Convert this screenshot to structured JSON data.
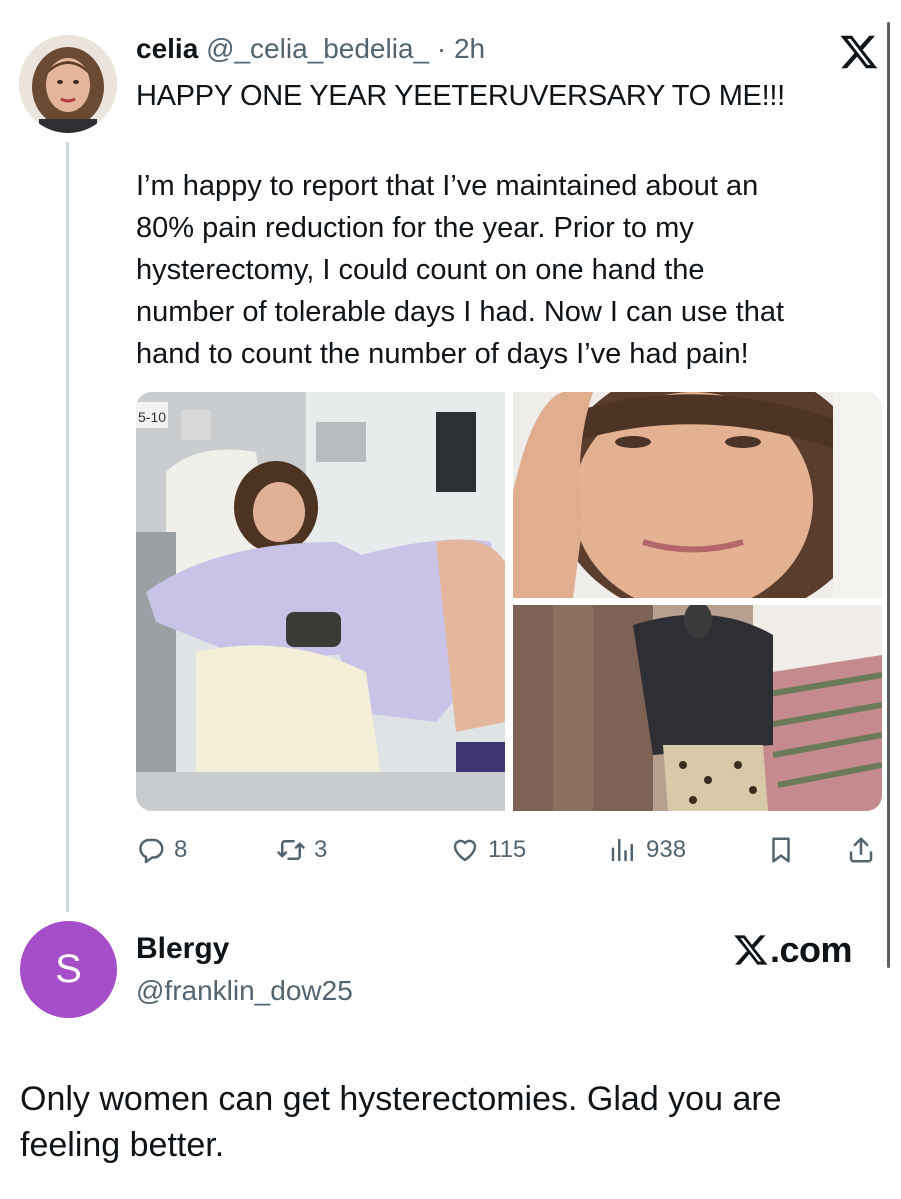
{
  "tweet": {
    "author_name": "celia",
    "author_handle": "@_celia_bedelia_",
    "separator": "·",
    "time": "2h",
    "title": "HAPPY ONE YEAR YEETERUVERSARY TO ME!!!",
    "body_lines": [
      "I’m happy to report that I’ve maintained about an",
      "80% pain reduction for the year. Prior to my",
      "hysterectomy, I could count on one hand the",
      "number of tolerable days I had. Now I can use that",
      "hand to count the number of days I’ve had pain!"
    ],
    "media": {
      "photo1_sign": "5-10"
    },
    "stats": {
      "replies": "8",
      "retweets": "3",
      "likes": "115",
      "views": "938"
    }
  },
  "reply": {
    "avatar_letter": "S",
    "author_name": "Blergy",
    "author_handle": "@franklin_dow25",
    "text_lines": [
      "Only women can get hysterectomies. Glad you are",
      "feeling better."
    ]
  },
  "watermark": {
    "domain_text": ".com"
  },
  "icons": {
    "top_right": "x-logo-icon",
    "actions": [
      "reply-icon",
      "retweet-icon",
      "like-icon",
      "views-icon",
      "bookmark-icon",
      "share-icon"
    ]
  },
  "colors": {
    "text": "#0f1419",
    "muted": "#536471",
    "thread_line": "#cfd9de",
    "reply_avatar_bg": "#a64dc9"
  }
}
